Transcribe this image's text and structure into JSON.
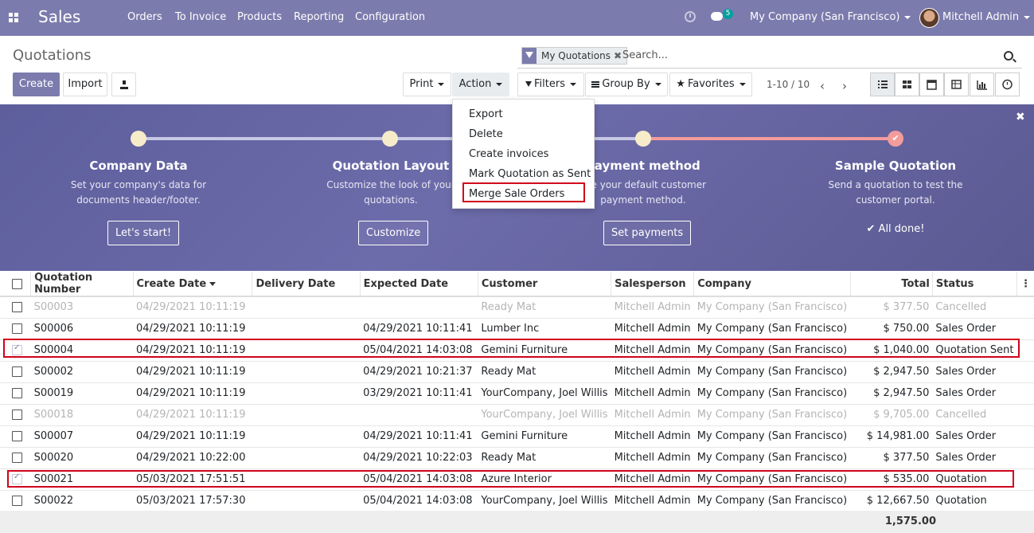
{
  "topbar": {
    "app_name": "Sales",
    "menu": [
      "Orders",
      "To Invoice",
      "Products",
      "Reporting",
      "Configuration"
    ],
    "chat_count": "5",
    "company": "My Company (San Francisco)",
    "user": "Mitchell Admin",
    "icons": [
      "apps-icon",
      "clock-icon",
      "chat-icon",
      "avatar"
    ]
  },
  "control_panel": {
    "title": "Quotations",
    "create_label": "Create",
    "import_label": "Import",
    "print_label": "Print",
    "action_label": "Action",
    "filters_label": "Filters",
    "groupby_label": "Group By",
    "favorites_label": "Favorites",
    "facet_label": "My Quotations",
    "search_placeholder": "Search...",
    "pager": "1-10 / 10",
    "views": [
      "list-view-icon",
      "kanban-view-icon",
      "calendar-view-icon",
      "pivot-view-icon",
      "graph-view-icon",
      "activity-view-icon"
    ]
  },
  "action_menu": {
    "items": [
      "Export",
      "Delete",
      "Create invoices",
      "Mark Quotation as Sent",
      "Merge Sale Orders"
    ]
  },
  "onboarding": {
    "steps": [
      {
        "title": "Company Data",
        "desc1": "Set your company's data for",
        "desc2": "documents header/footer.",
        "button": "Let's start!"
      },
      {
        "title": "Quotation Layout",
        "desc1": "Customize the look of your",
        "desc2": "quotations.",
        "button": "Customize"
      },
      {
        "title": "Payment method",
        "desc1": "ose your default customer",
        "desc2": "payment method.",
        "button": "Set payments"
      },
      {
        "title": "Sample Quotation",
        "desc1": "Send a quotation to test the",
        "desc2": "customer portal.",
        "button": "✔ All done!"
      }
    ]
  },
  "table": {
    "columns": [
      "Quotation Number",
      "Create Date",
      "Delivery Date",
      "Expected Date",
      "Customer",
      "Salesperson",
      "Company",
      "Total",
      "Status"
    ],
    "rows": [
      {
        "number": "S00003",
        "create": "04/29/2021 10:11:19",
        "delivery": "",
        "expected": "",
        "customer": "Ready Mat",
        "salesperson": "Mitchell Admin",
        "company": "My Company (San Francisco)",
        "total": "$ 377.50",
        "status": "Cancelled"
      },
      {
        "number": "S00006",
        "create": "04/29/2021 10:11:19",
        "delivery": "",
        "expected": "04/29/2021 10:11:41",
        "customer": "Lumber Inc",
        "salesperson": "Mitchell Admin",
        "company": "My Company (San Francisco)",
        "total": "$ 750.00",
        "status": "Sales Order"
      },
      {
        "number": "S00004",
        "create": "04/29/2021 10:11:19",
        "delivery": "",
        "expected": "05/04/2021 14:03:08",
        "customer": "Gemini Furniture",
        "salesperson": "Mitchell Admin",
        "company": "My Company (San Francisco)",
        "total": "$ 1,040.00",
        "status": "Quotation Sent"
      },
      {
        "number": "S00002",
        "create": "04/29/2021 10:11:19",
        "delivery": "",
        "expected": "04/29/2021 10:21:37",
        "customer": "Ready Mat",
        "salesperson": "Mitchell Admin",
        "company": "My Company (San Francisco)",
        "total": "$ 2,947.50",
        "status": "Sales Order"
      },
      {
        "number": "S00019",
        "create": "04/29/2021 10:11:19",
        "delivery": "",
        "expected": "03/29/2021 10:11:41",
        "customer": "YourCompany, Joel Willis",
        "salesperson": "Mitchell Admin",
        "company": "My Company (San Francisco)",
        "total": "$ 2,947.50",
        "status": "Sales Order"
      },
      {
        "number": "S00018",
        "create": "04/29/2021 10:11:19",
        "delivery": "",
        "expected": "",
        "customer": "YourCompany, Joel Willis",
        "salesperson": "Mitchell Admin",
        "company": "My Company (San Francisco)",
        "total": "$ 9,705.00",
        "status": "Cancelled"
      },
      {
        "number": "S00007",
        "create": "04/29/2021 10:11:19",
        "delivery": "",
        "expected": "04/29/2021 10:11:41",
        "customer": "Gemini Furniture",
        "salesperson": "Mitchell Admin",
        "company": "My Company (San Francisco)",
        "total": "$ 14,981.00",
        "status": "Sales Order"
      },
      {
        "number": "S00020",
        "create": "04/29/2021 10:22:00",
        "delivery": "",
        "expected": "04/29/2021 10:22:03",
        "customer": "Ready Mat",
        "salesperson": "Mitchell Admin",
        "company": "My Company (San Francisco)",
        "total": "$ 377.50",
        "status": "Sales Order"
      },
      {
        "number": "S00021",
        "create": "05/03/2021 17:51:51",
        "delivery": "",
        "expected": "05/04/2021 14:03:08",
        "customer": "Azure Interior",
        "salesperson": "Mitchell Admin",
        "company": "My Company (San Francisco)",
        "total": "$ 535.00",
        "status": "Quotation"
      },
      {
        "number": "S00022",
        "create": "05/03/2021 17:57:30",
        "delivery": "",
        "expected": "05/04/2021 14:03:08",
        "customer": "YourCompany, Joel Willis",
        "salesperson": "Mitchell Admin",
        "company": "My Company (San Francisco)",
        "total": "$ 12,667.50",
        "status": "Quotation"
      }
    ],
    "footer_total": "1,575.00"
  },
  "colors": {
    "brand": "#7c7bad",
    "highlight": "#d0021b",
    "cancelled_text": "#b4b4b4"
  }
}
